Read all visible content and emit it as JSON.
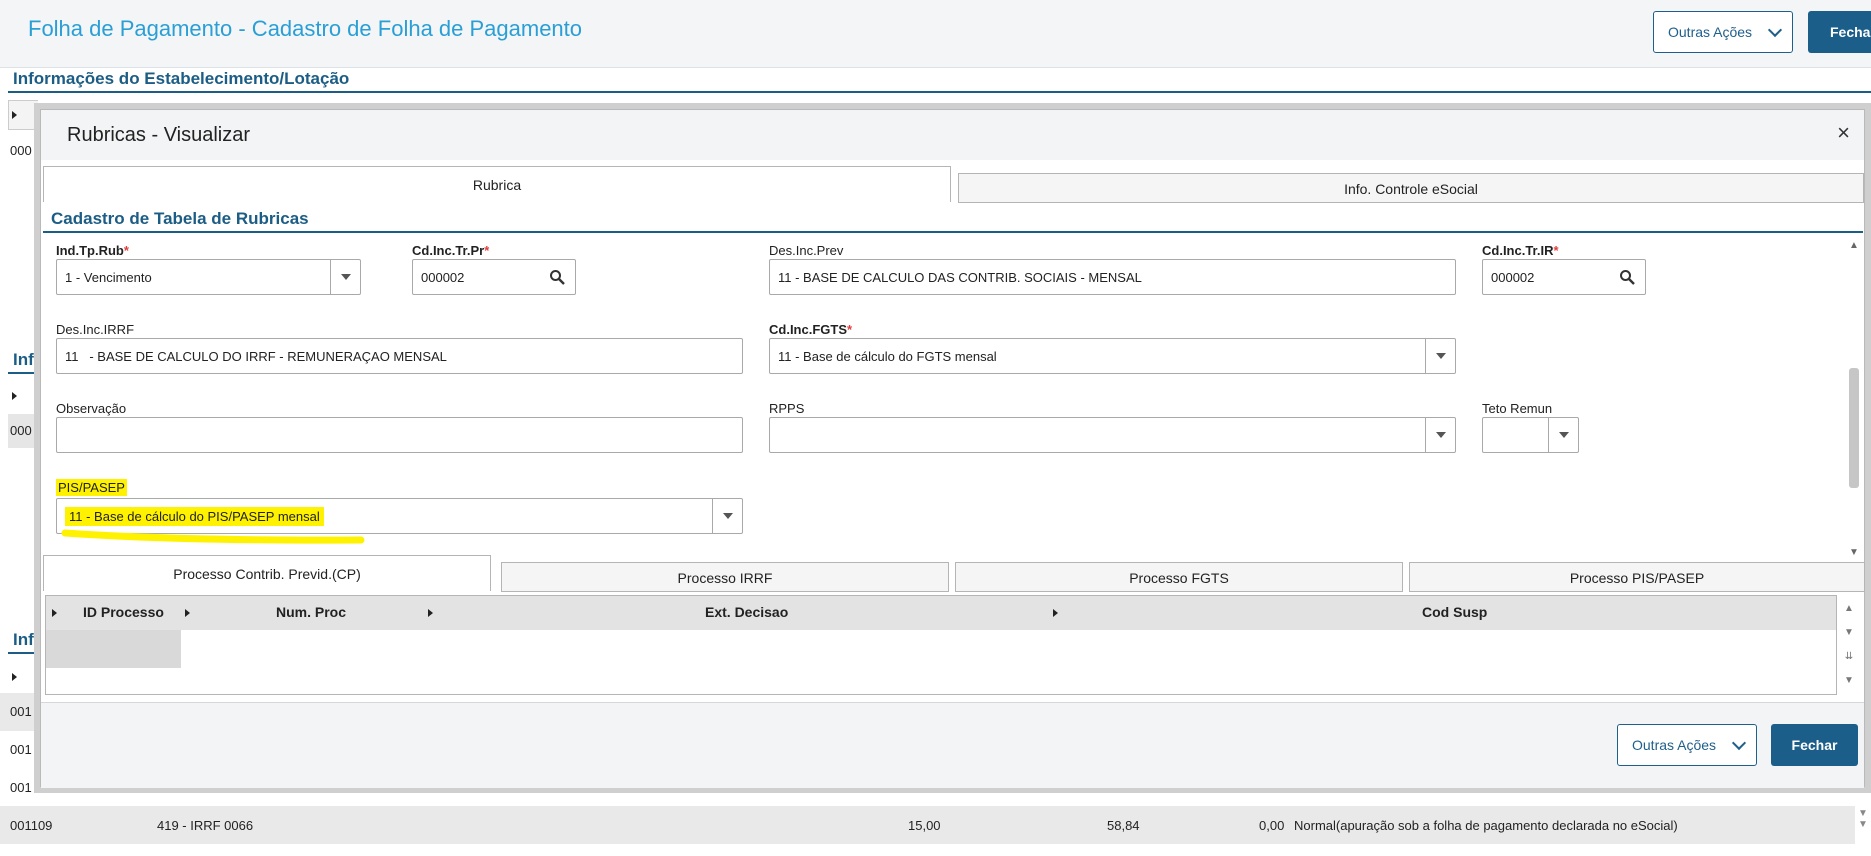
{
  "page": {
    "title": "Folha de Pagamento - Cadastro de Folha de Pagamento",
    "other_actions_label": "Outras Ações",
    "close_label": "Fechar",
    "section1_title": "Informações do Estabelecimento/Lotação",
    "section_inf_a": "Inf",
    "section_inf_b": "Inf",
    "row_codes": [
      "000",
      "000",
      "001",
      "001",
      "001"
    ],
    "last_row": {
      "code": "001109",
      "rubric": "419 - IRRF 0066",
      "v1": "15,00",
      "v2": "58,84",
      "v3": "0,00",
      "desc": "Normal(apuração sob a folha de pagamento declarada no eSocial)"
    }
  },
  "modal": {
    "title": "Rubricas - Visualizar",
    "close_icon": "×",
    "tabs": [
      "Rubrica",
      "Info. Controle eSocial"
    ],
    "section_title": "Cadastro de Tabela de Rubricas",
    "fields": {
      "ind_tp_rub": {
        "label": "Ind.Tp.Rub",
        "value": "1 - Vencimento"
      },
      "cd_inc_tr_pr": {
        "label": "Cd.Inc.Tr.Pr",
        "value": "000002"
      },
      "des_inc_prev": {
        "label": "Des.Inc.Prev",
        "value": "11 - BASE DE CALCULO DAS CONTRIB. SOCIAIS - MENSAL"
      },
      "cd_inc_tr_ir": {
        "label": "Cd.Inc.Tr.IR",
        "value": "000002"
      },
      "des_inc_irrf": {
        "label": "Des.Inc.IRRF",
        "value": "11   - BASE DE CALCULO DO IRRF - REMUNERAÇAO MENSAL"
      },
      "cd_inc_fgts": {
        "label": "Cd.Inc.FGTS",
        "value": "11 - Base de cálculo do FGTS mensal"
      },
      "observacao": {
        "label": "Observação",
        "value": ""
      },
      "rpps": {
        "label": "RPPS",
        "value": ""
      },
      "teto_remun": {
        "label": "Teto Remun",
        "value": ""
      },
      "pis_pasep": {
        "label": "PIS/PASEP",
        "value": "11 - Base de cálculo do PIS/PASEP mensal"
      }
    },
    "process_tabs": [
      "Processo Contrib. Previd.(CP)",
      "Processo IRRF",
      "Processo FGTS",
      "Processo PIS/PASEP"
    ],
    "grid_columns": [
      "ID Processo",
      "Num. Proc",
      "Ext. Decisao",
      "Cod Susp"
    ],
    "footer": {
      "other_actions_label": "Outras Ações",
      "close_label": "Fechar"
    }
  },
  "colors": {
    "accent": "#1c5d85",
    "title_blue": "#2a9fd6",
    "highlight": "#fff200",
    "primary_button": "#1b5e8a"
  }
}
